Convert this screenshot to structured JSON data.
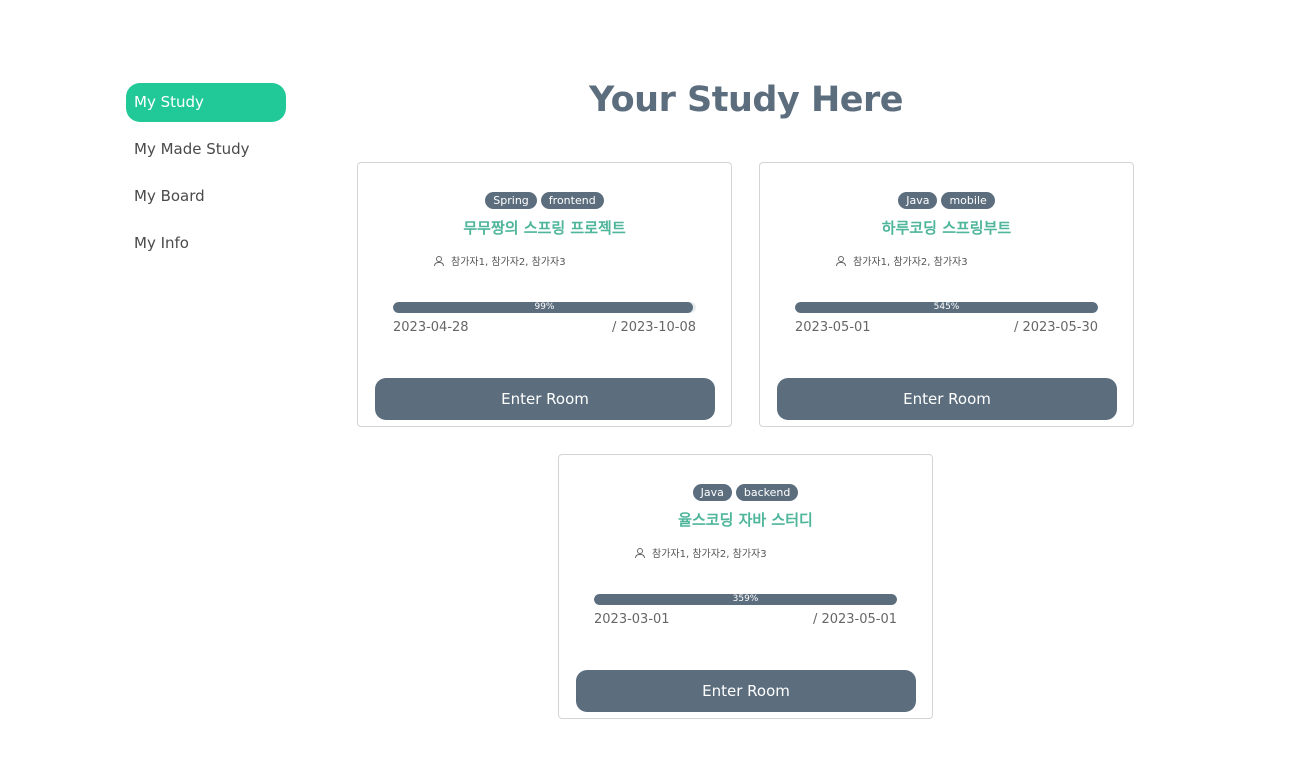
{
  "sidebar": {
    "items": [
      {
        "label": "My Study",
        "active": true
      },
      {
        "label": "My Made Study",
        "active": false
      },
      {
        "label": "My Board",
        "active": false
      },
      {
        "label": "My Info",
        "active": false
      }
    ]
  },
  "main": {
    "title": "Your Study Here",
    "cards": [
      {
        "tags": [
          "Spring",
          "frontend"
        ],
        "title": "무무짱의 스프링 프로젝트",
        "members": "참가자1, 참가자2, 참가자3",
        "progress_label": "99%",
        "progress_value": 0.99,
        "start_date": "2023-04-28",
        "end_date": "/ 2023-10-08",
        "button_label": "Enter Room"
      },
      {
        "tags": [
          "Java",
          "mobile"
        ],
        "title": "하루코딩 스프링부트",
        "members": "참가자1, 참가자2, 참가자3",
        "progress_label": "545%",
        "progress_value": 1.0,
        "start_date": "2023-05-01",
        "end_date": "/ 2023-05-30",
        "button_label": "Enter Room"
      },
      {
        "tags": [
          "Java",
          "backend"
        ],
        "title": "율스코딩 자바 스터디",
        "members": "참가자1, 참가자2, 참가자3",
        "progress_label": "359%",
        "progress_value": 1.0,
        "start_date": "2023-03-01",
        "end_date": "/ 2023-05-01",
        "button_label": "Enter Room"
      }
    ]
  },
  "colors": {
    "accent": "#20c997",
    "slate": "#5c6e7e",
    "title_green": "#4fb69c"
  }
}
